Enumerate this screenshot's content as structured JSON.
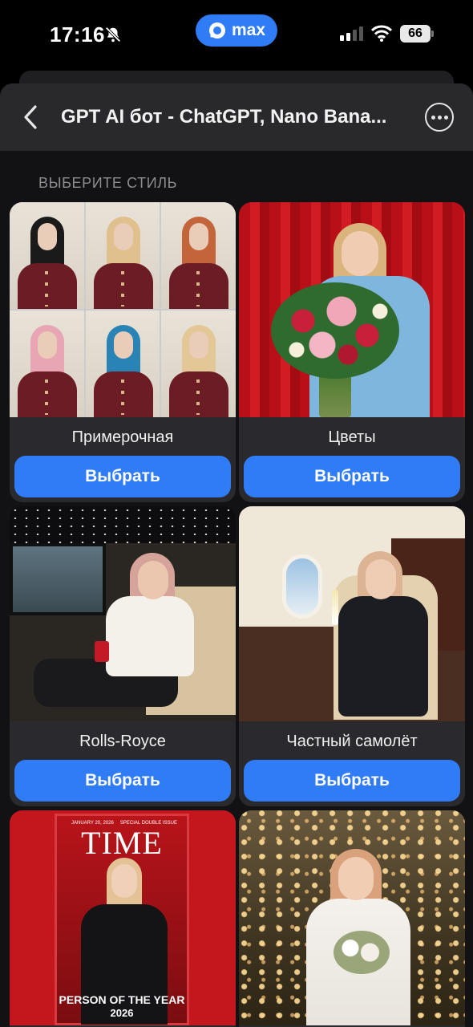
{
  "status_bar": {
    "time": "17:16",
    "app_badge": "max",
    "battery": "66"
  },
  "header": {
    "title": "GPT AI бот - ChatGPT, Nano Bana..."
  },
  "section_label": "ВЫБЕРИТЕ СТИЛЬ",
  "cards": [
    {
      "name": "Примерочная",
      "button": "Выбрать"
    },
    {
      "name": "Цветы",
      "button": "Выбрать"
    },
    {
      "name": "Rolls-Royce",
      "button": "Выбрать"
    },
    {
      "name": "Частный самолёт",
      "button": "Выбрать"
    },
    {
      "name": "",
      "button": ""
    },
    {
      "name": "",
      "button": ""
    }
  ],
  "time_cover": {
    "date": "JANUARY 20, 2026",
    "issue": "SPECIAL DOUBLE ISSUE",
    "logo": "TIME",
    "headline": "PERSON OF THE YEAR",
    "year": "2026"
  },
  "colors": {
    "accent": "#2f7cf6",
    "card_bg": "#2a2a2e",
    "nav_bg": "#29292c"
  },
  "icons": [
    "bell-slash-icon",
    "max-logo-icon",
    "signal-icon",
    "wifi-icon",
    "battery-icon",
    "chevron-left-icon",
    "more-icon"
  ]
}
